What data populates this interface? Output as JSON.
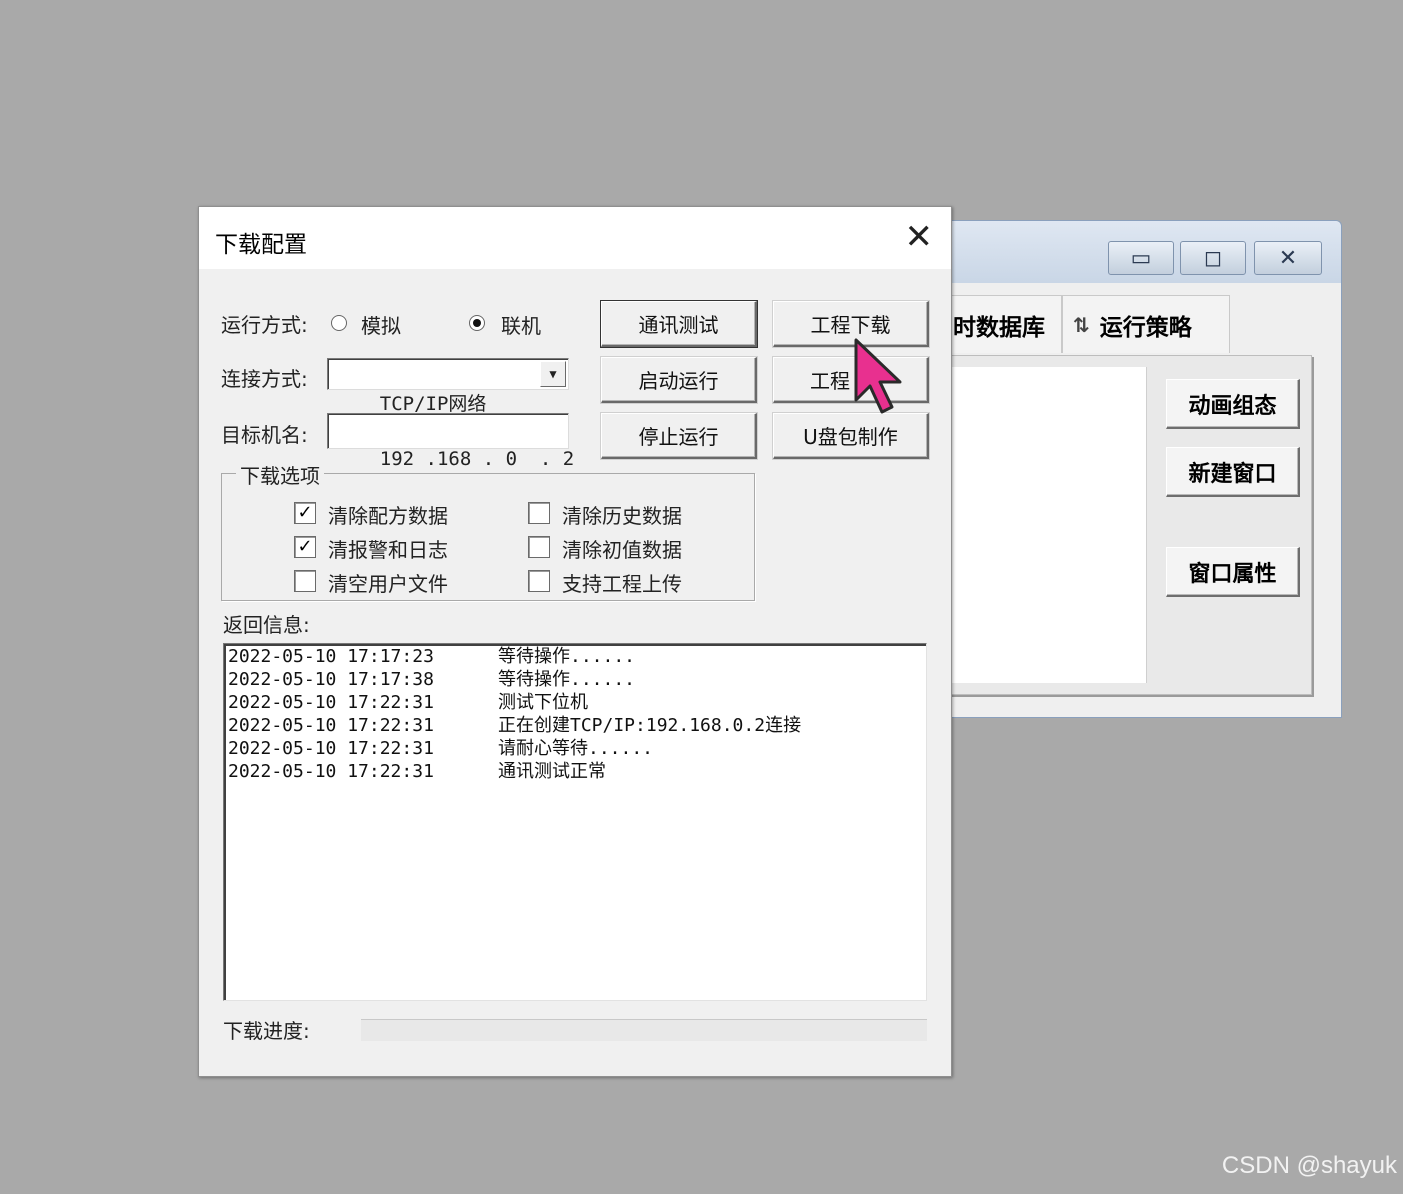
{
  "bg_window": {
    "tabs": [
      {
        "label": "时数据库"
      },
      {
        "label": "运行策略"
      }
    ],
    "buttons": [
      {
        "label": "动画组态"
      },
      {
        "label": "新建窗口"
      },
      {
        "label": "窗口属性"
      }
    ]
  },
  "dialog": {
    "title": "下载配置",
    "run_mode": {
      "label": "运行方式:",
      "options": [
        {
          "label": "模拟",
          "selected": false
        },
        {
          "label": "联机",
          "selected": true
        }
      ]
    },
    "connection": {
      "label": "连接方式:",
      "value": "TCP/IP网络"
    },
    "target": {
      "label": "目标机名:",
      "value": "192 .168 . 0  . 2"
    },
    "buttons": {
      "comm_test": "通讯测试",
      "project_download": "工程下载",
      "start_run": "启动运行",
      "project_upload": "工程",
      "stop_run": "停止运行",
      "udisk_make": "U盘包制作"
    },
    "options_group": {
      "legend": "下载选项",
      "items": [
        {
          "label": "清除配方数据",
          "checked": true
        },
        {
          "label": "清除历史数据",
          "checked": false
        },
        {
          "label": "清报警和日志",
          "checked": true
        },
        {
          "label": "清除初值数据",
          "checked": false
        },
        {
          "label": "清空用户文件",
          "checked": false
        },
        {
          "label": "支持工程上传",
          "checked": false
        }
      ]
    },
    "log_label": "返回信息:",
    "log": [
      {
        "time": "2022-05-10 17:17:23",
        "msg": "等待操作......"
      },
      {
        "time": "2022-05-10 17:17:38",
        "msg": "等待操作......"
      },
      {
        "time": "2022-05-10 17:22:31",
        "msg": "测试下位机"
      },
      {
        "time": "2022-05-10 17:22:31",
        "msg": "正在创建TCP/IP:192.168.0.2连接"
      },
      {
        "time": "2022-05-10 17:22:31",
        "msg": "请耐心等待......"
      },
      {
        "time": "2022-05-10 17:22:31",
        "msg": "通讯测试正常"
      }
    ],
    "progress": {
      "label": "下载进度:",
      "value": 0
    }
  },
  "watermark": "CSDN @shayuk",
  "colors": {
    "cursor": "#e8308f"
  }
}
